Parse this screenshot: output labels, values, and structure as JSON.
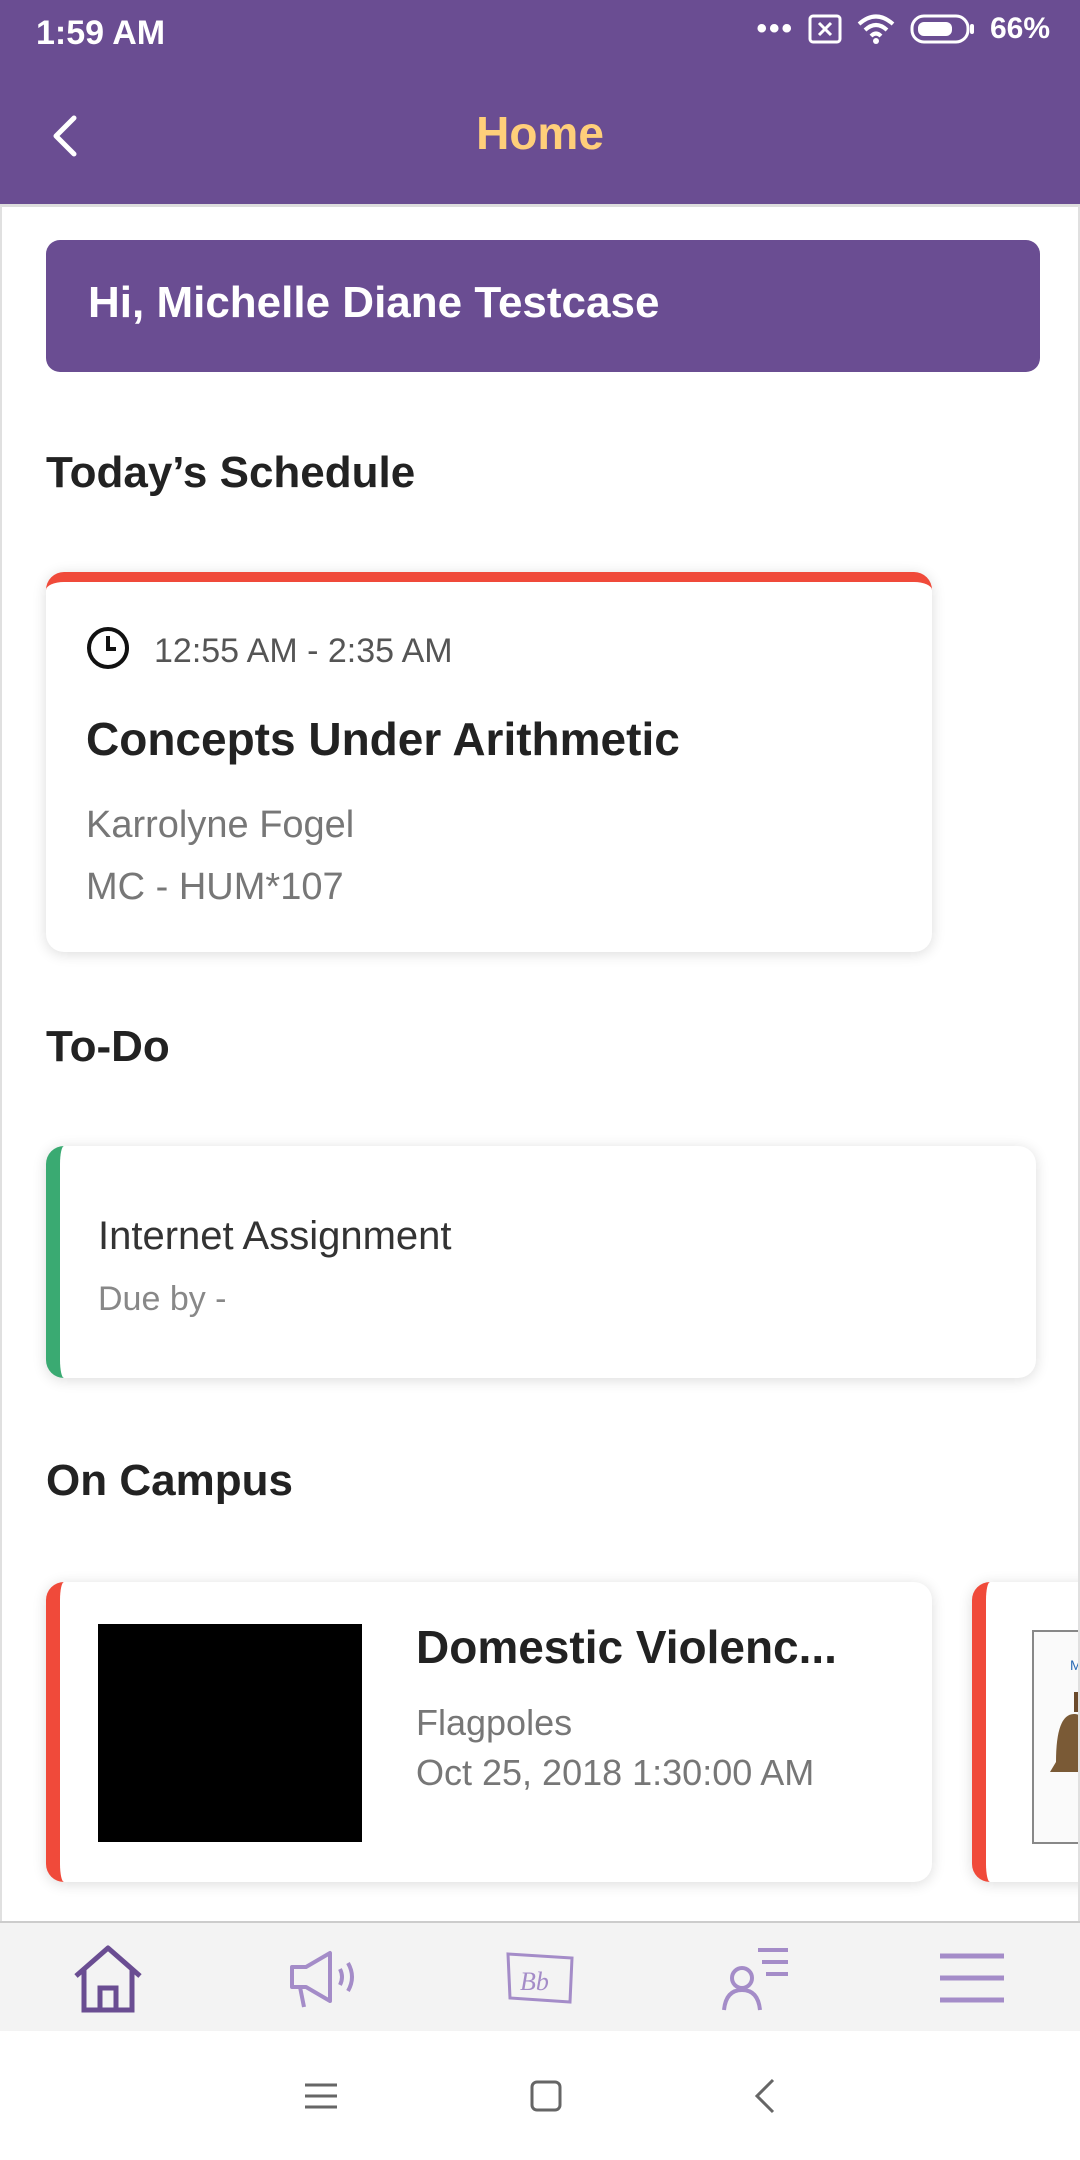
{
  "status_bar": {
    "time": "1:59 AM",
    "battery": "66%"
  },
  "app_bar": {
    "title": "Home"
  },
  "greeting": "Hi, Michelle Diane Testcase",
  "schedule": {
    "section_title": "Today’s Schedule",
    "time_range": "12:55 AM - 2:35 AM",
    "course": "Concepts Under Arithmetic",
    "instructor": "Karrolyne Fogel",
    "location": "MC - HUM*107"
  },
  "todo": {
    "section_title": "To-Do",
    "item_title": "Internet Assignment",
    "item_due": "Due by -"
  },
  "campus": {
    "section_title": "On Campus",
    "event_title": "Domestic Violenc...",
    "event_location": "Flagpoles",
    "event_date": "Oct 25, 2018 1:30:00 AM"
  },
  "bottom_nav": [
    {
      "icon": "home-icon"
    },
    {
      "icon": "megaphone-icon"
    },
    {
      "icon": "blackboard-icon",
      "label": "Bb"
    },
    {
      "icon": "profile-list-icon"
    },
    {
      "icon": "menu-icon"
    }
  ],
  "colors": {
    "primary": "#6a4d92",
    "title_accent": "#ffcf7a",
    "schedule_accent": "#f04a3a",
    "todo_accent": "#3aaa72",
    "nav_icon": "#a48cc8"
  }
}
